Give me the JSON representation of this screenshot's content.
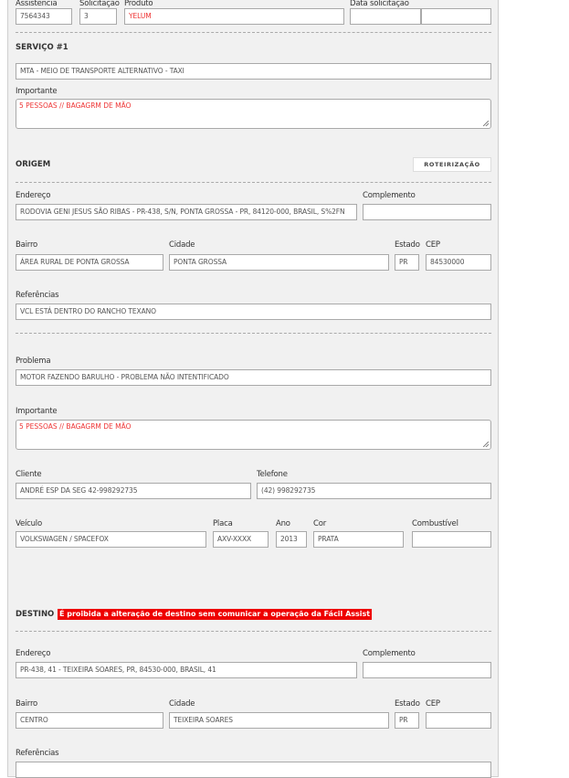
{
  "header_fields": {
    "assistencia_label": "Assistencia",
    "assistencia": "7564343",
    "solicitacao_label": "Solicitação",
    "solicitacao": "3",
    "produto_label": "Produto",
    "produto": "YELUM",
    "data_label": "Data solicitação",
    "data": "",
    "hora": ""
  },
  "servico": {
    "title": "SERVIÇO #1",
    "tipo": "MTA - MEIO DE TRANSPORTE ALTERNATIVO - TAXI",
    "importante_label": "Importante",
    "importante": "5 PESSOAS // BAGAGRM DE MÃO"
  },
  "origem": {
    "title": "ORIGEM",
    "roteirizacao_button": "ROTEIRIZAÇÃO",
    "endereco_label": "Endereço",
    "endereco": "RODOVIA GENI JESUS SÃO RIBAS - PR-438, S/N, PONTA GROSSA - PR, 84120-000, BRASIL, S%2FN",
    "complemento_label": "Complemento",
    "complemento": "",
    "bairro_label": "Bairro",
    "bairro": "ÁREA RURAL DE PONTA GROSSA",
    "cidade_label": "Cidade",
    "cidade": "PONTA GROSSA",
    "estado_label": "Estado",
    "estado": "PR",
    "cep_label": "CEP",
    "cep": "84530000",
    "referencias_label": "Referências",
    "referencias": "VCL ESTÁ DENTRO DO  RANCHO TEXANO"
  },
  "ocorrencia": {
    "problema_label": "Problema",
    "problema": "MOTOR FAZENDO BARULHO - PROBLEMA NÃO INTENTIFICADO",
    "importante_label": "Importante",
    "importante": "5 PESSOAS // BAGAGRM DE MÃO",
    "cliente_label": "Cliente",
    "cliente": "ANDRÉ ESP DA SEG  42-998292735",
    "telefone_label": "Telefone",
    "telefone": "(42) 998292735",
    "veiculo_label": "Veículo",
    "veiculo": "VOLKSWAGEN / SPACEFOX",
    "placa_label": "Placa",
    "placa": "AXV-XXXX",
    "ano_label": "Ano",
    "ano": "2013",
    "cor_label": "Cor",
    "cor": "PRATA",
    "combustivel_label": "Combustível",
    "combustivel": ""
  },
  "destino": {
    "title": "DESTINO",
    "warning": "É proibida a alteração de destino sem comunicar a operação da Fácil Assist",
    "endereco_label": "Endereço",
    "endereco": "PR-438, 41 - TEIXEIRA SOARES, PR, 84530-000, BRASIL, 41",
    "complemento_label": "Complemento",
    "complemento": "",
    "bairro_label": "Bairro",
    "bairro": "CENTRO",
    "cidade_label": "Cidade",
    "cidade": "TEIXEIRA SOARES",
    "estado_label": "Estado",
    "estado": "PR",
    "cep_label": "CEP",
    "cep": "",
    "referencias_label": "Referências"
  },
  "colors": {
    "panel": "#f1f1f1",
    "warning": "#e00000",
    "highlight_text": "#e33333"
  }
}
